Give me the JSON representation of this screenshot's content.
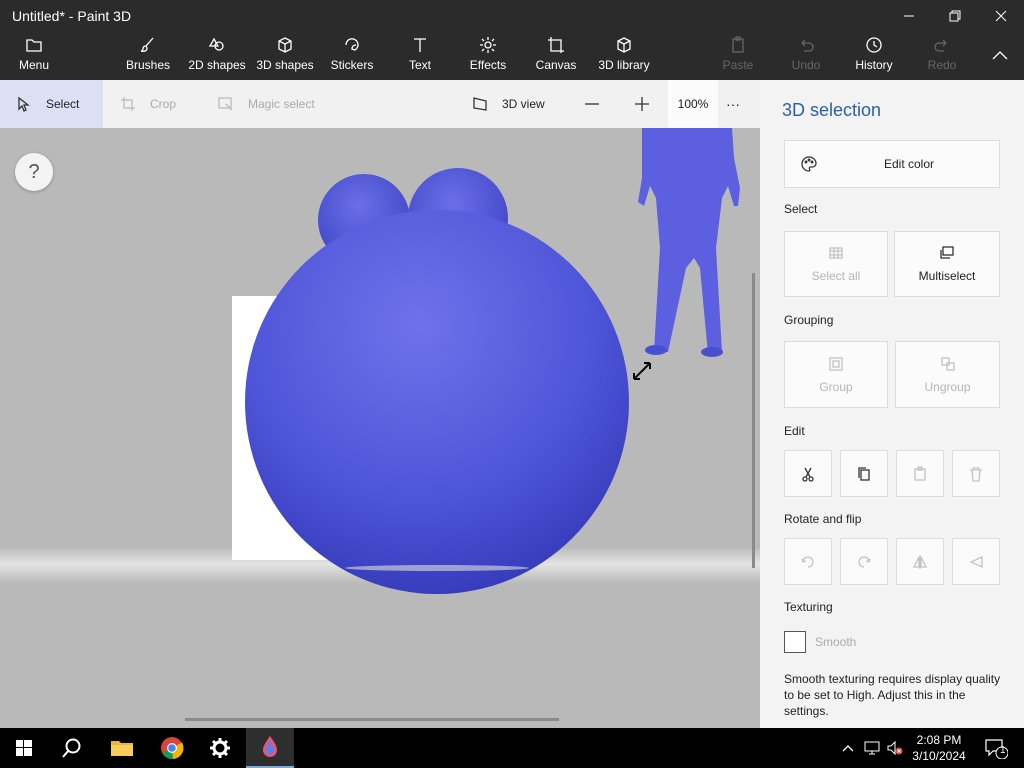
{
  "app": {
    "title": "Untitled* - Paint 3D"
  },
  "ribbon": {
    "menu": "Menu",
    "brushes": "Brushes",
    "shapes2d": "2D shapes",
    "shapes3d": "3D shapes",
    "stickers": "Stickers",
    "text": "Text",
    "effects": "Effects",
    "canvas": "Canvas",
    "library": "3D library",
    "paste": "Paste",
    "undo": "Undo",
    "history": "History",
    "redo": "Redo"
  },
  "toolbar": {
    "select": "Select",
    "crop": "Crop",
    "magic_select": "Magic select",
    "view3d": "3D view",
    "zoom": "100%",
    "more": "···"
  },
  "canvas": {
    "help": "?"
  },
  "panel": {
    "title": "3D selection",
    "edit_color": "Edit color",
    "select_label": "Select",
    "select_all": "Select all",
    "multiselect": "Multiselect",
    "grouping_label": "Grouping",
    "group": "Group",
    "ungroup": "Ungroup",
    "edit_label": "Edit",
    "rotate_label": "Rotate and flip",
    "texturing_label": "Texturing",
    "smooth": "Smooth",
    "note": "Smooth texturing requires display quality to be set to High. Adjust this in the settings."
  },
  "taskbar": {
    "time": "2:08 PM",
    "date": "3/10/2024",
    "notification_count": "1"
  },
  "colors": {
    "shape_blue": "#5a5ee0",
    "accent": "#2a5fb0",
    "selected_tool_bg": "#dbe0f4"
  }
}
